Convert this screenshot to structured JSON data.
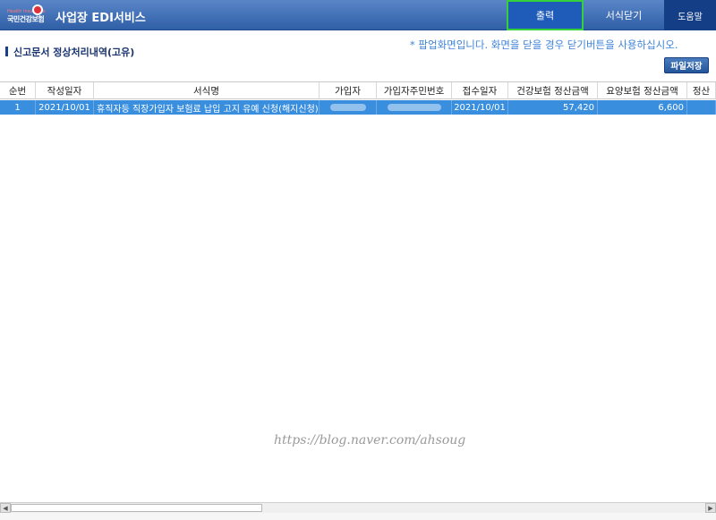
{
  "header": {
    "logo_tagline": "Health Insurance",
    "logo_text": "국민건강보험",
    "app_title": "사업장 EDI서비스",
    "buttons": {
      "print": "출력",
      "close": "서식닫기",
      "help": "도움말"
    },
    "accent": "#2f5fa6",
    "print_highlight": "#35d03a"
  },
  "section": {
    "title": "신고문서 정상처리내역(고유)",
    "notice": "* 팝업화면입니다. 화면을 닫을 경우 닫기버튼을 사용하십시오.",
    "save_button": "파일저장"
  },
  "table": {
    "columns": [
      "순번",
      "작성일자",
      "서식명",
      "가입자",
      "가입자주민번호",
      "접수일자",
      "건강보험 정산금액",
      "요양보험 정산금액",
      "정산"
    ],
    "rows": [
      {
        "no": "1",
        "written_date": "2021/10/01",
        "form_name": "휴직자등 직장가입자 보험료 납입 고지 유예 신청(해지신청)",
        "subscriber": "",
        "resident_no": "",
        "receipt_date": "2021/10/01",
        "health_amount": "57,420",
        "care_amount": "6,600",
        "settlement": ""
      }
    ],
    "selected_color": "#3a8ede"
  },
  "watermark": "https://blog.naver.com/ahsoug",
  "icons": {
    "scroll_left": "arrow-left-icon",
    "scroll_right": "arrow-right-icon"
  }
}
